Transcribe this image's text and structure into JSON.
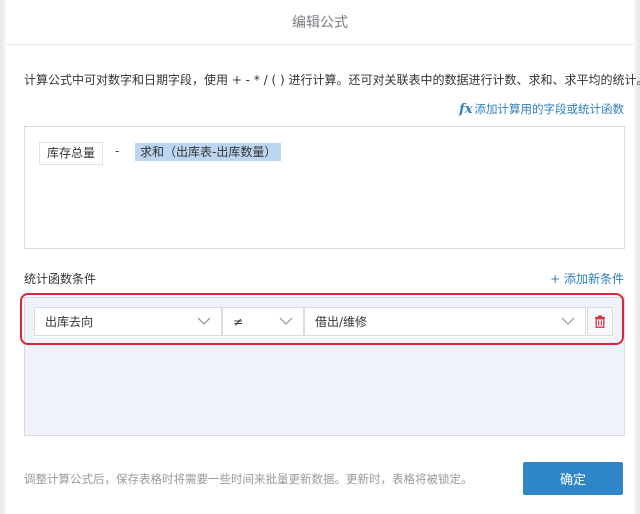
{
  "dialog": {
    "title": "编辑公式",
    "intro": "计算公式中可对数字和日期字段，使用 + - * / ( ) 进行计算。还可对关联表中的数据进行计数、求和、求平均的统计。",
    "add_field_icon": "fx",
    "add_field_link": "添加计算用的字段或统计函数"
  },
  "formula": {
    "tokens": {
      "field": "库存总量",
      "operator": "-",
      "aggregate": "求和（出库表-出库数量）"
    }
  },
  "conditions": {
    "label": "统计函数条件",
    "add_link": "+ 添加新条件",
    "row": {
      "field": "出库去向",
      "operator": "≠",
      "value": "借出/维修"
    }
  },
  "footer": {
    "note": "调整计算公式后，保存表格时将需要一些时间来批量更新数据。更新时，表格将被锁定。",
    "confirm": "确定"
  },
  "colors": {
    "accent": "#2e86c9",
    "link": "#2e7fc0",
    "highlight": "#d9253c",
    "token_bg": "#bcd6f0",
    "panel_bg": "#f0f2fb"
  },
  "icons": [
    "fx-icon",
    "chevron-down-icon",
    "trash-icon"
  ]
}
